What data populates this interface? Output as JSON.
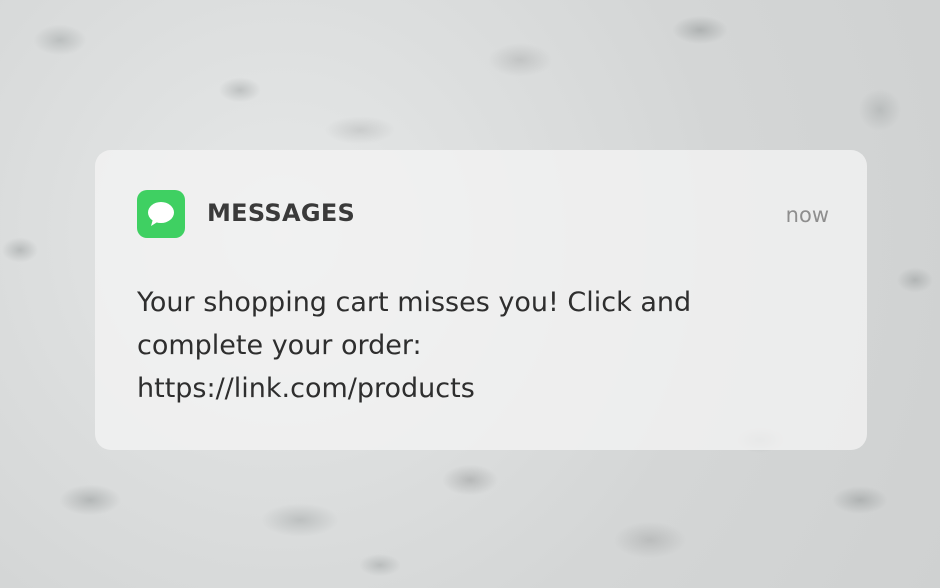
{
  "notification": {
    "app_name": "MESSAGES",
    "timestamp": "now",
    "icon": "messages-bubble-icon",
    "icon_color": "#3fd062",
    "message_lines": [
      "Your shopping cart misses you! Click and",
      "complete your order:",
      "https://link.com/products"
    ]
  }
}
